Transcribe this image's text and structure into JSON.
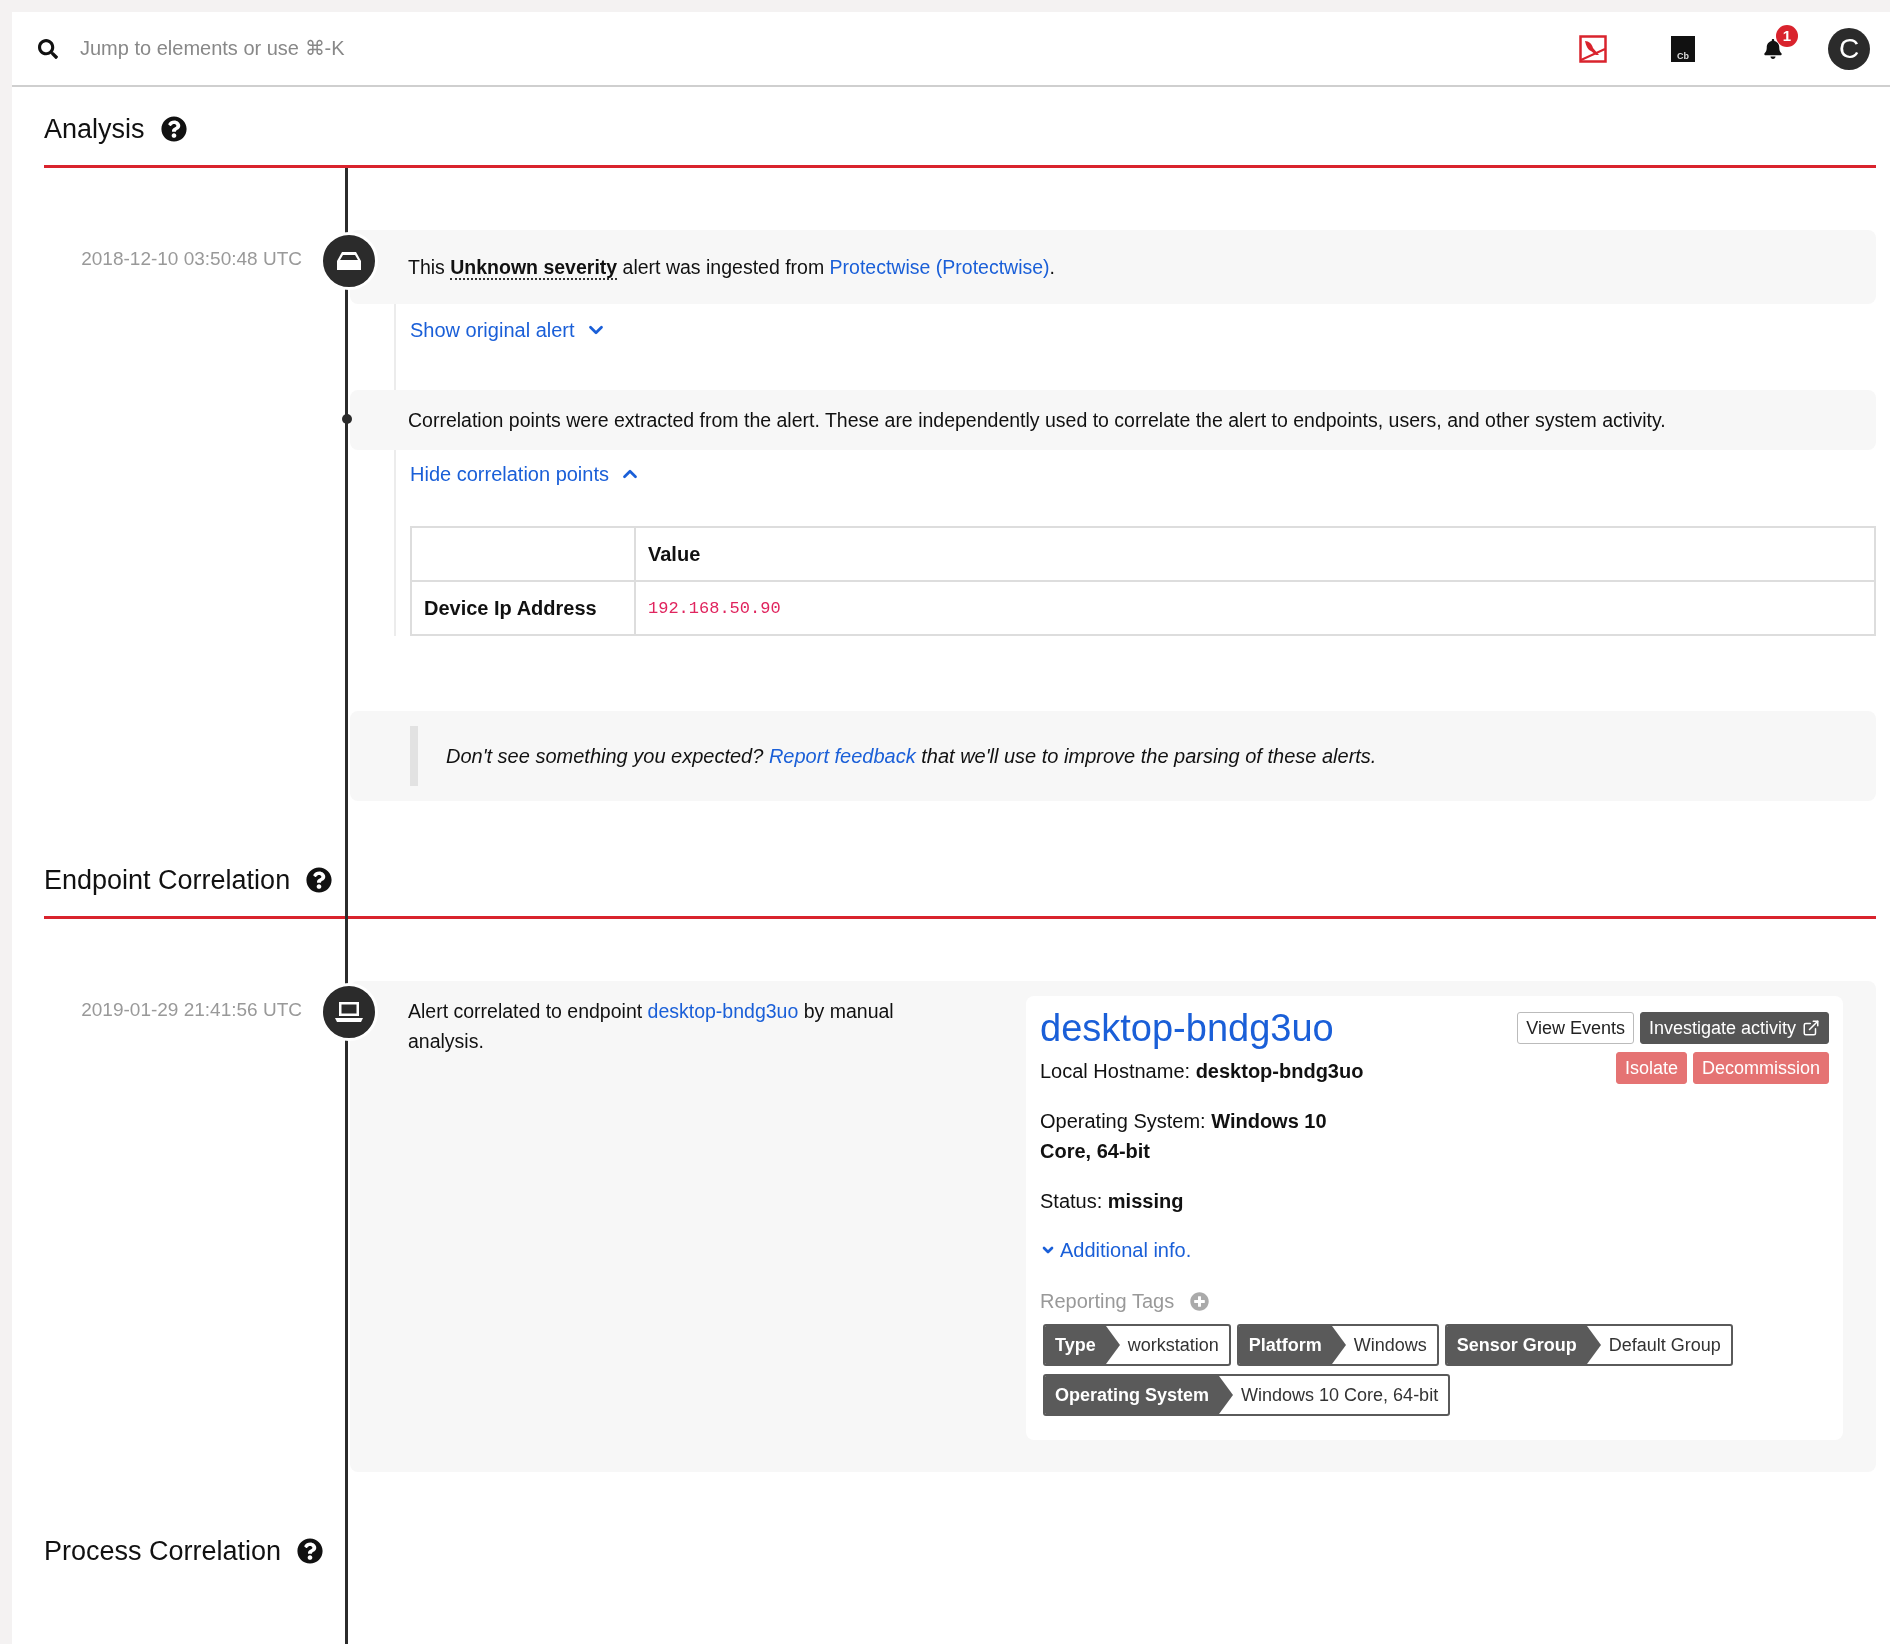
{
  "search": {
    "placeholder": "Jump to elements or use ⌘-K"
  },
  "toolbar": {
    "logo_text": "Cb",
    "notification_count": "1",
    "avatar_initial": "C"
  },
  "analysis": {
    "title": "Analysis",
    "alert_event": {
      "timestamp": "2018-12-10 03:50:48 UTC",
      "message": "This **Unknown severity** alert was ingested from ",
      "source_link": "Protectwise (Protectwise)",
      "message_end": ".",
      "toggle": {
        "label": "Show original alert",
        "expanded": false
      }
    },
    "correlation_event": {
      "message": "Correlation points were extracted from the alert. These are independently used to correlate the alert to endpoints, users, and other system activity.",
      "toggle": {
        "label": "Hide correlation points",
        "expanded": true
      },
      "table": {
        "columns": [
          "Value"
        ],
        "rows": [
          {
            "name": "Device Ip Address",
            "value": "192.168.50.90"
          }
        ]
      }
    },
    "feedback": {
      "before": "Don't see something you expected? ",
      "link": "Report feedback",
      "after": " that we'll use to improve the parsing of these alerts."
    }
  },
  "endpoint_correlation": {
    "title": "Endpoint Correlation",
    "event": {
      "timestamp": "2019-01-29 21:41:56 UTC",
      "before": "Alert correlated to endpoint ",
      "link": "desktop-bndg3uo",
      "after": " by manual analysis."
    },
    "card": {
      "hostname": "desktop-bndg3uo",
      "fields": [
        {
          "label": "Local Hostname: ",
          "value": "desktop-bndg3uo"
        },
        {
          "label": "Operating System: ",
          "value": "Windows 10 Core, 64-bit"
        },
        {
          "label": "Status: ",
          "value": "missing"
        }
      ],
      "buttons": [
        {
          "label": "View Events",
          "kind": "outline"
        },
        {
          "label": "Investigate activity",
          "kind": "dark"
        },
        {
          "label": "Isolate",
          "kind": "danger"
        },
        {
          "label": "Decommission",
          "kind": "danger"
        }
      ],
      "additional": {
        "label": "Additional info.",
        "expanded": false
      },
      "tags_label": "Reporting Tags",
      "tags": [
        {
          "key": "Type",
          "value": "workstation"
        },
        {
          "key": "Platform",
          "value": "Windows"
        },
        {
          "key": "Sensor Group",
          "value": "Default Group"
        },
        {
          "key": "Operating System",
          "value": "Windows 10 Core, 64-bit"
        }
      ]
    }
  },
  "process_correlation": {
    "title": "Process Correlation"
  }
}
